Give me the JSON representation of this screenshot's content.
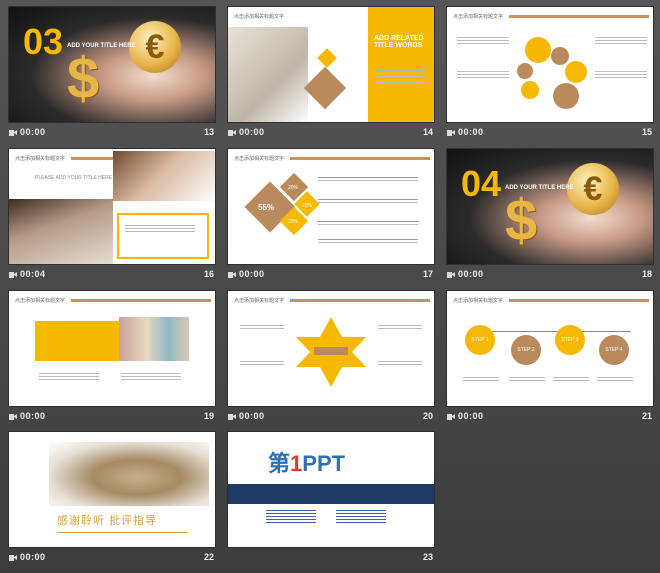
{
  "header_text": "点击添加相关标题文字",
  "slides": [
    {
      "num": "13",
      "time": "00:00",
      "kind": "photo",
      "big": "03",
      "title": "ADD YOUR TITLE HERE"
    },
    {
      "num": "14",
      "time": "00:00",
      "kind": "office",
      "title": "ADD RELATED TITLE WORDS"
    },
    {
      "num": "15",
      "time": "00:00",
      "kind": "circles"
    },
    {
      "num": "16",
      "time": "00:04",
      "kind": "glasses",
      "title": "PLEASE ADD YOUR TITLE HERE"
    },
    {
      "num": "17",
      "time": "00:00",
      "kind": "diamonds",
      "p1": "55%",
      "p2": "20%",
      "p3": "20%",
      "p4": "20%"
    },
    {
      "num": "18",
      "time": "00:00",
      "kind": "photo",
      "big": "04",
      "title": "ADD YOUR TITLE HERE"
    },
    {
      "num": "19",
      "time": "00:00",
      "kind": "market"
    },
    {
      "num": "20",
      "time": "00:00",
      "kind": "star"
    },
    {
      "num": "21",
      "time": "00:00",
      "kind": "steps",
      "steps": [
        "STEP 1",
        "STEP 2",
        "STEP 3",
        "STEP 4"
      ]
    },
    {
      "num": "22",
      "time": "00:00",
      "kind": "thanks",
      "thanks": "感谢聆听 批评指导"
    },
    {
      "num": "23",
      "time": "",
      "kind": "ppt",
      "logo_a": "第",
      "logo_b": "1",
      "logo_c": "PPT"
    }
  ],
  "colors": {
    "gold": "#f6b800",
    "brown": "#b98a5c",
    "bg": "#4a4a4a"
  }
}
